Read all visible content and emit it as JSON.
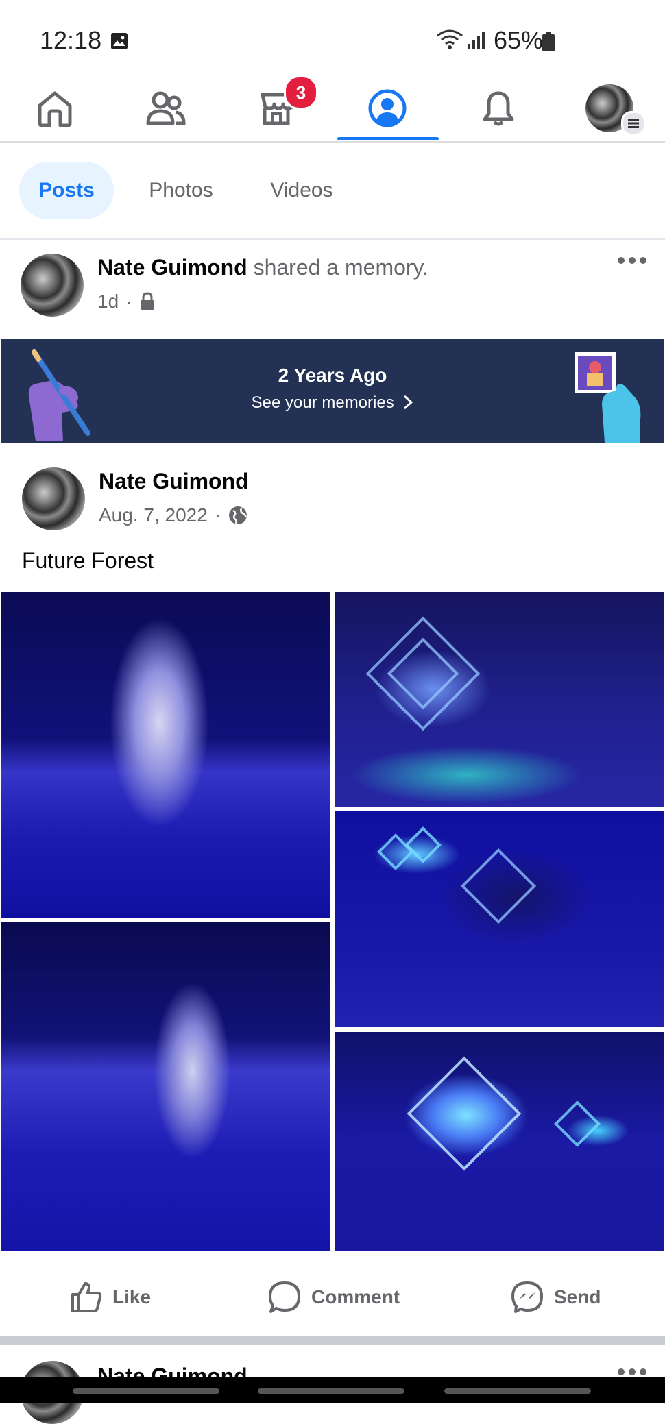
{
  "status_bar": {
    "time": "12:18",
    "battery": "65%"
  },
  "nav": {
    "items": [
      "home",
      "friends",
      "marketplace",
      "profile",
      "notifications",
      "menu"
    ],
    "marketplace_badge": "3",
    "active": "profile"
  },
  "tabs": [
    "Posts",
    "Photos",
    "Videos"
  ],
  "post": {
    "author": "Nate Guimond",
    "action": "shared a memory.",
    "time": "1d",
    "privacy": "lock-icon",
    "memory": {
      "title": "2 Years Ago",
      "link": "See your memories"
    },
    "original": {
      "author": "Nate Guimond",
      "date": "Aug. 7, 2022",
      "privacy": "globe-icon",
      "text": "Future Forest"
    },
    "actions": {
      "like": "Like",
      "comment": "Comment",
      "send": "Send"
    }
  },
  "next_post": {
    "author": "Nate Guimond"
  },
  "colors": {
    "accent": "#1877f2",
    "banner": "#233154",
    "badge": "#e41e3f"
  }
}
